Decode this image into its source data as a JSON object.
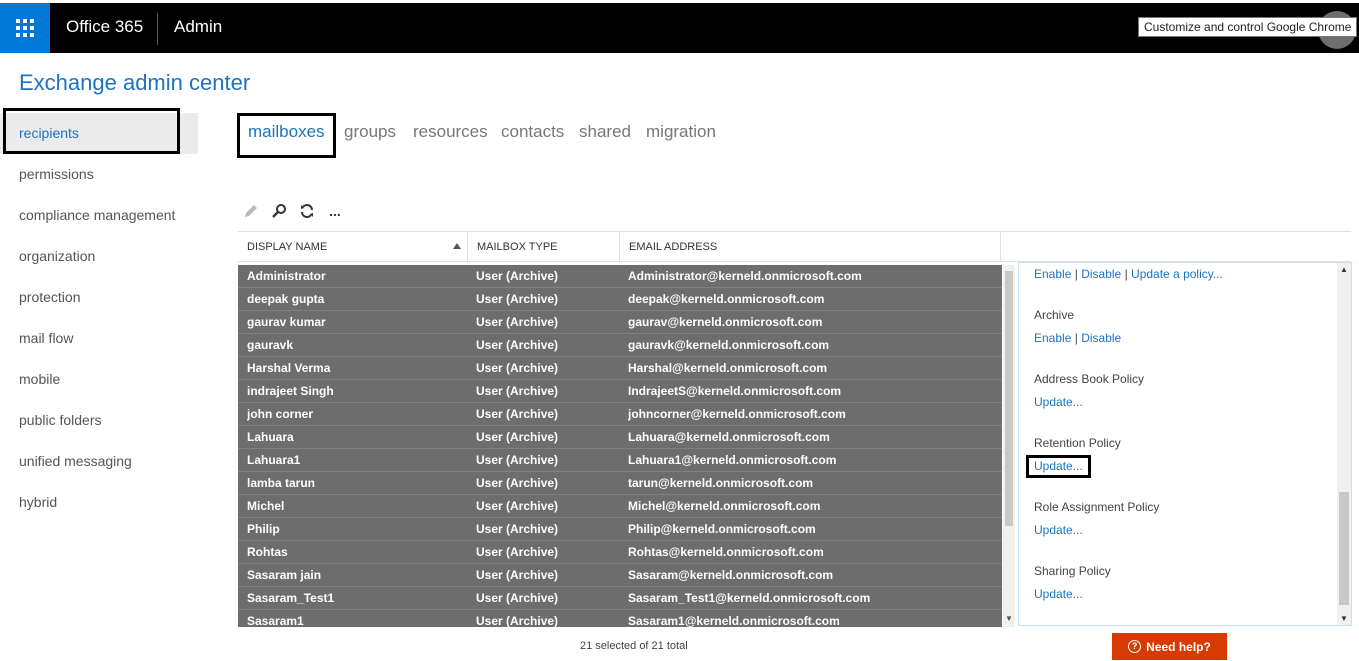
{
  "topbar": {
    "brand": "Office 365",
    "app": "Admin",
    "tooltip": "Customize and control Google Chrome"
  },
  "page_title": "Exchange admin center",
  "nav": [
    "recipients",
    "permissions",
    "compliance management",
    "organization",
    "protection",
    "mail flow",
    "mobile",
    "public folders",
    "unified messaging",
    "hybrid"
  ],
  "tabs": [
    "mailboxes",
    "groups",
    "resources",
    "contacts",
    "shared",
    "migration"
  ],
  "toolbar": {
    "edit": "pencil-icon",
    "search": "search-icon",
    "refresh": "refresh-icon",
    "more": "more-icon",
    "more_label": "..."
  },
  "columns": {
    "display_name": "DISPLAY NAME",
    "mailbox_type": "MAILBOX TYPE",
    "email": "EMAIL ADDRESS"
  },
  "rows": [
    [
      "Administrator",
      "User (Archive)",
      "Administrator@kerneld.onmicrosoft.com"
    ],
    [
      "deepak gupta",
      "User (Archive)",
      "deepak@kerneld.onmicrosoft.com"
    ],
    [
      "gaurav kumar",
      "User (Archive)",
      "gaurav@kerneld.onmicrosoft.com"
    ],
    [
      "gauravk",
      "User (Archive)",
      "gauravk@kerneld.onmicrosoft.com"
    ],
    [
      "Harshal Verma",
      "User (Archive)",
      "Harshal@kerneld.onmicrosoft.com"
    ],
    [
      "indrajeet Singh",
      "User (Archive)",
      "IndrajeetS@kerneld.onmicrosoft.com"
    ],
    [
      "john corner",
      "User (Archive)",
      "johncorner@kerneld.onmicrosoft.com"
    ],
    [
      "Lahuara",
      "User (Archive)",
      "Lahuara@kerneld.onmicrosoft.com"
    ],
    [
      "Lahuara1",
      "User (Archive)",
      "Lahuara1@kerneld.onmicrosoft.com"
    ],
    [
      "lamba tarun",
      "User (Archive)",
      "tarun@kerneld.onmicrosoft.com"
    ],
    [
      "Michel",
      "User (Archive)",
      "Michel@kerneld.onmicrosoft.com"
    ],
    [
      "Philip",
      "User (Archive)",
      "Philip@kerneld.onmicrosoft.com"
    ],
    [
      "Rohtas",
      "User (Archive)",
      "Rohtas@kerneld.onmicrosoft.com"
    ],
    [
      "Sasaram jain",
      "User (Archive)",
      "Sasaram@kerneld.onmicrosoft.com"
    ],
    [
      "Sasaram_Test1",
      "User (Archive)",
      "Sasaram_Test1@kerneld.onmicrosoft.com"
    ],
    [
      "Sasaram1",
      "User (Archive)",
      "Sasaram1@kerneld.onmicrosoft.com"
    ]
  ],
  "details": {
    "top_links": {
      "enable": "Enable",
      "disable": "Disable",
      "update_policy": "Update a policy...",
      "sep": "|"
    },
    "archive": {
      "label": "Archive",
      "enable": "Enable",
      "disable": "Disable"
    },
    "address_book": {
      "label": "Address Book Policy",
      "link": "Update..."
    },
    "retention": {
      "label": "Retention Policy",
      "link": "Update..."
    },
    "role_assignment": {
      "label": "Role Assignment Policy",
      "link": "Update..."
    },
    "sharing": {
      "label": "Sharing Policy",
      "link": "Update..."
    }
  },
  "footer": {
    "count": "21 selected of 21 total",
    "help": "Need help?"
  },
  "colors": {
    "accent": "#1e73be",
    "topbar": "#000000",
    "waffle": "#0078d7",
    "selected_row": "#6d6d6d",
    "help": "#d83b01"
  }
}
